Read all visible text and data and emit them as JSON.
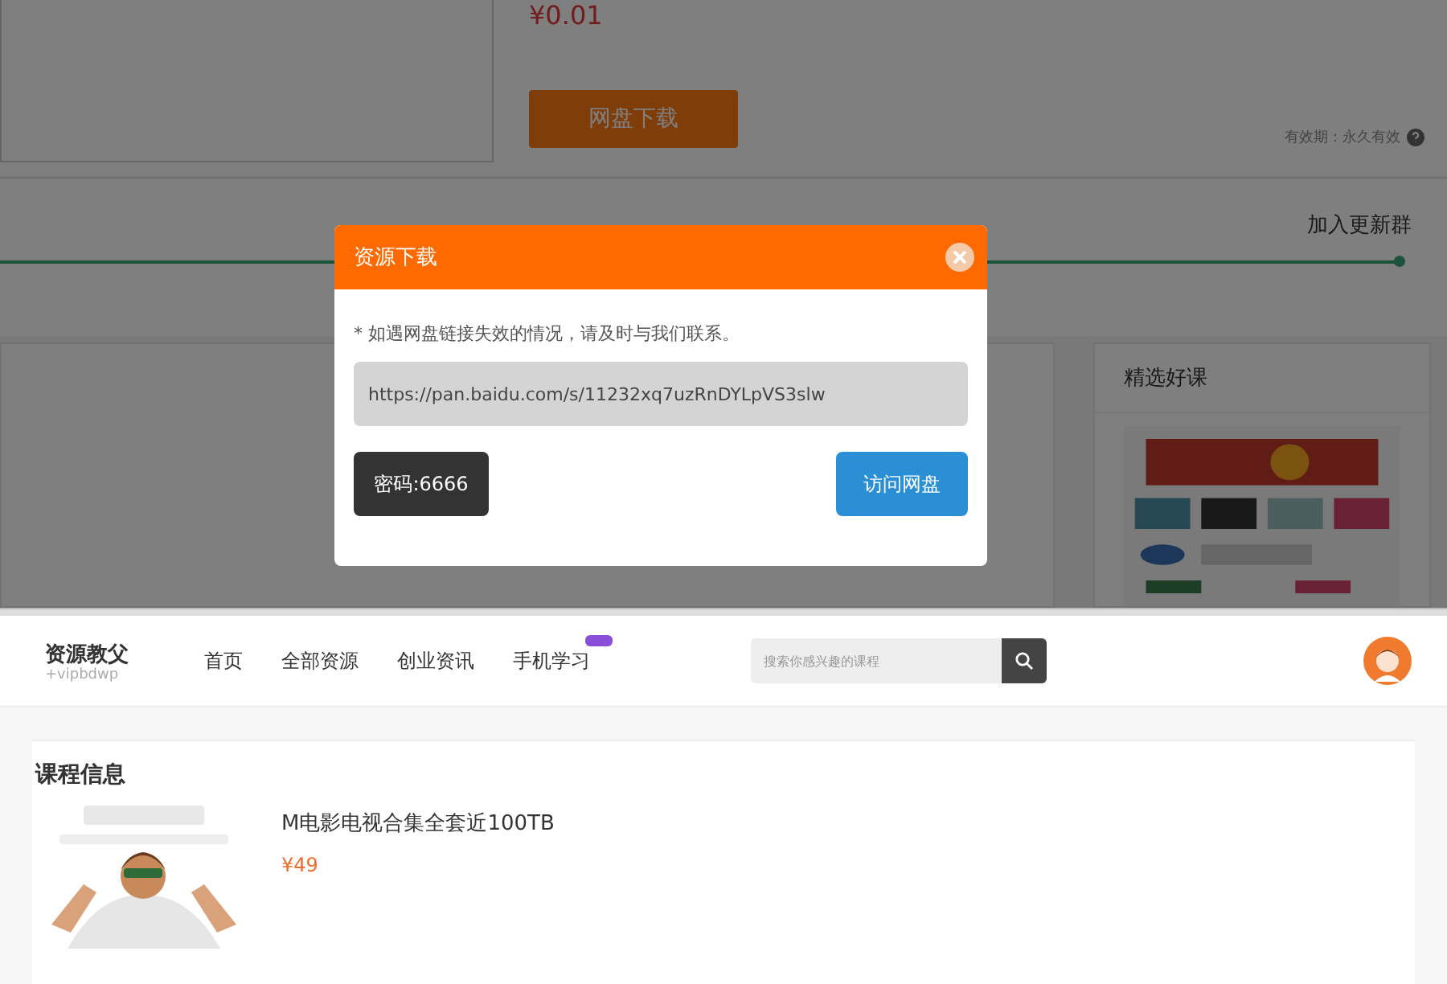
{
  "background_page": {
    "price": "¥0.01",
    "download_button": "网盘下载",
    "validity": "有效期：永久有效",
    "join_group": "加入更新群",
    "featured": {
      "title": "精选好课",
      "kind": "picture"
    }
  },
  "dialog": {
    "title": "资源下载",
    "notice": "* 如遇网盘链接失效的情况，请及时与我们联系。",
    "link": "https://pan.baidu.com/s/11232xq7uzRnDYLpVS3slw",
    "password": "密码:6666",
    "open_button": "访问网盘"
  },
  "header": {
    "logo": "资源教父",
    "logo_sub": "+vipbdwp",
    "nav": [
      {
        "label": "首页",
        "new_badge": false
      },
      {
        "label": "全部资源",
        "new_badge": false
      },
      {
        "label": "创业资讯",
        "new_badge": false
      },
      {
        "label": "手机学习",
        "new_badge": true
      }
    ],
    "search": {
      "placeholder": "搜索你感兴趣的课程"
    }
  },
  "course": {
    "heading": "课程信息",
    "title": "M电影电视合集全套近100TB",
    "price": "¥49"
  }
}
